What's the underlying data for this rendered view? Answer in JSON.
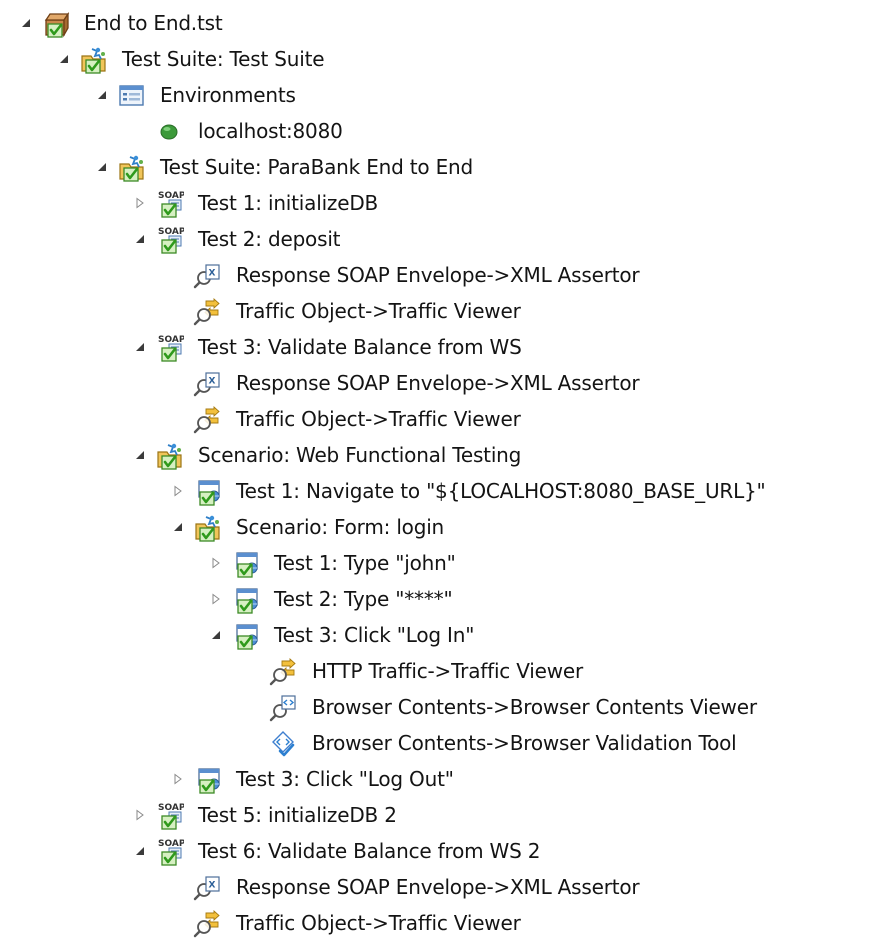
{
  "tree": {
    "items": [
      {
        "label": "End to End.tst",
        "icon": "tst-file-icon",
        "toggle": "expanded"
      },
      {
        "label": "Test Suite: Test Suite",
        "icon": "test-suite-icon",
        "toggle": "expanded"
      },
      {
        "label": "Environments",
        "icon": "environments-icon",
        "toggle": "expanded"
      },
      {
        "label": "localhost:8080",
        "icon": "environment-icon",
        "toggle": "none"
      },
      {
        "label": "Test Suite: ParaBank End to End",
        "icon": "test-suite-icon",
        "toggle": "expanded"
      },
      {
        "label": "Test 1: initializeDB",
        "icon": "soap-client-icon",
        "toggle": "collapsed"
      },
      {
        "label": "Test 2: deposit",
        "icon": "soap-client-icon",
        "toggle": "expanded"
      },
      {
        "label": "Response SOAP Envelope->XML Assertor",
        "icon": "xml-assertor-icon",
        "toggle": "none"
      },
      {
        "label": "Traffic Object->Traffic Viewer",
        "icon": "traffic-viewer-icon",
        "toggle": "none"
      },
      {
        "label": "Test 3: Validate Balance from WS",
        "icon": "soap-client-icon",
        "toggle": "expanded"
      },
      {
        "label": "Response SOAP Envelope->XML Assertor",
        "icon": "xml-assertor-icon",
        "toggle": "none"
      },
      {
        "label": "Traffic Object->Traffic Viewer",
        "icon": "traffic-viewer-icon",
        "toggle": "none"
      },
      {
        "label": "Scenario: Web Functional Testing",
        "icon": "scenario-icon",
        "toggle": "expanded"
      },
      {
        "label": "Test 1: Navigate to \"${LOCALHOST:8080_BASE_URL}\"",
        "icon": "browser-test-icon",
        "toggle": "collapsed"
      },
      {
        "label": "Scenario: Form: login",
        "icon": "scenario-icon",
        "toggle": "expanded"
      },
      {
        "label": "Test 1: Type \"john\"",
        "icon": "browser-test-icon",
        "toggle": "collapsed"
      },
      {
        "label": "Test 2: Type \"****\"",
        "icon": "browser-test-icon",
        "toggle": "collapsed"
      },
      {
        "label": "Test 3: Click \"Log In\"",
        "icon": "browser-test-icon",
        "toggle": "expanded"
      },
      {
        "label": "HTTP Traffic->Traffic Viewer",
        "icon": "traffic-viewer-icon",
        "toggle": "none"
      },
      {
        "label": "Browser Contents->Browser Contents Viewer",
        "icon": "browser-contents-viewer-icon",
        "toggle": "none"
      },
      {
        "label": "Browser Contents->Browser Validation Tool",
        "icon": "browser-validation-tool-icon",
        "toggle": "none"
      },
      {
        "label": "Test 3: Click \"Log Out\"",
        "icon": "browser-test-icon",
        "toggle": "collapsed"
      },
      {
        "label": "Test 5: initializeDB 2",
        "icon": "soap-client-icon",
        "toggle": "collapsed"
      },
      {
        "label": "Test 6: Validate Balance from WS 2",
        "icon": "soap-client-icon",
        "toggle": "expanded"
      },
      {
        "label": "Response SOAP Envelope->XML Assertor",
        "icon": "xml-assertor-icon",
        "toggle": "none"
      },
      {
        "label": "Traffic Object->Traffic Viewer",
        "icon": "traffic-viewer-icon",
        "toggle": "none"
      }
    ]
  }
}
